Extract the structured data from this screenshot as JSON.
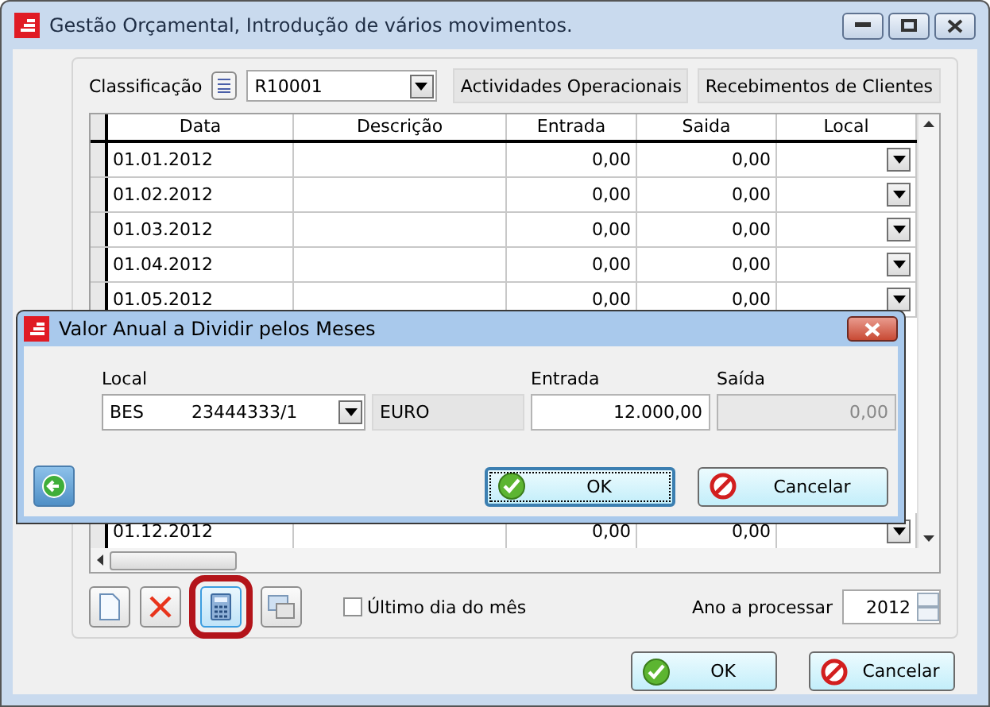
{
  "window": {
    "title": "Gestão Orçamental, Introdução de vários movimentos."
  },
  "classification": {
    "label": "Classificação",
    "value": "R10001",
    "fields": [
      "Actividades Operacionais",
      "Recebimentos de Clientes"
    ]
  },
  "table": {
    "columns": [
      "Data",
      "Descrição",
      "Entrada",
      "Saida",
      "Local"
    ],
    "rows": [
      {
        "date": "01.01.2012",
        "entrada": "0,00",
        "saida": "0,00"
      },
      {
        "date": "01.02.2012",
        "entrada": "0,00",
        "saida": "0,00"
      },
      {
        "date": "01.03.2012",
        "entrada": "0,00",
        "saida": "0,00"
      },
      {
        "date": "01.04.2012",
        "entrada": "0,00",
        "saida": "0,00"
      },
      {
        "date": "01.05.2012",
        "entrada": "0,00",
        "saida": "0,00"
      },
      {
        "date": "01.12.2012",
        "entrada": "0,00",
        "saida": "0,00"
      }
    ]
  },
  "tools": [
    {
      "kind": "new",
      "highlighted": false
    },
    {
      "kind": "delete",
      "highlighted": false
    },
    {
      "kind": "calculator",
      "highlighted": true
    },
    {
      "kind": "window",
      "highlighted": false
    }
  ],
  "last_day": {
    "label": "Último dia do mês",
    "checked": false
  },
  "year": {
    "label": "Ano a processar",
    "value": "2012"
  },
  "buttons": [
    {
      "kind": "ok",
      "label": "OK"
    },
    {
      "kind": "cancel",
      "label": "Cancelar"
    }
  ],
  "dialog": {
    "title": "Valor Anual a Dividir pelos Meses",
    "local": {
      "label": "Local",
      "code": "BES",
      "account": "23444333/1"
    },
    "currency": "EURO",
    "entrada": {
      "label": "Entrada",
      "value": "12.000,00",
      "disabled": false
    },
    "saida": {
      "label": "Saída",
      "value": "0,00",
      "disabled": true
    },
    "buttons": [
      {
        "kind": "ok",
        "label": "OK",
        "focused": true
      },
      {
        "kind": "cancel",
        "label": "Cancelar",
        "focused": false
      }
    ]
  }
}
